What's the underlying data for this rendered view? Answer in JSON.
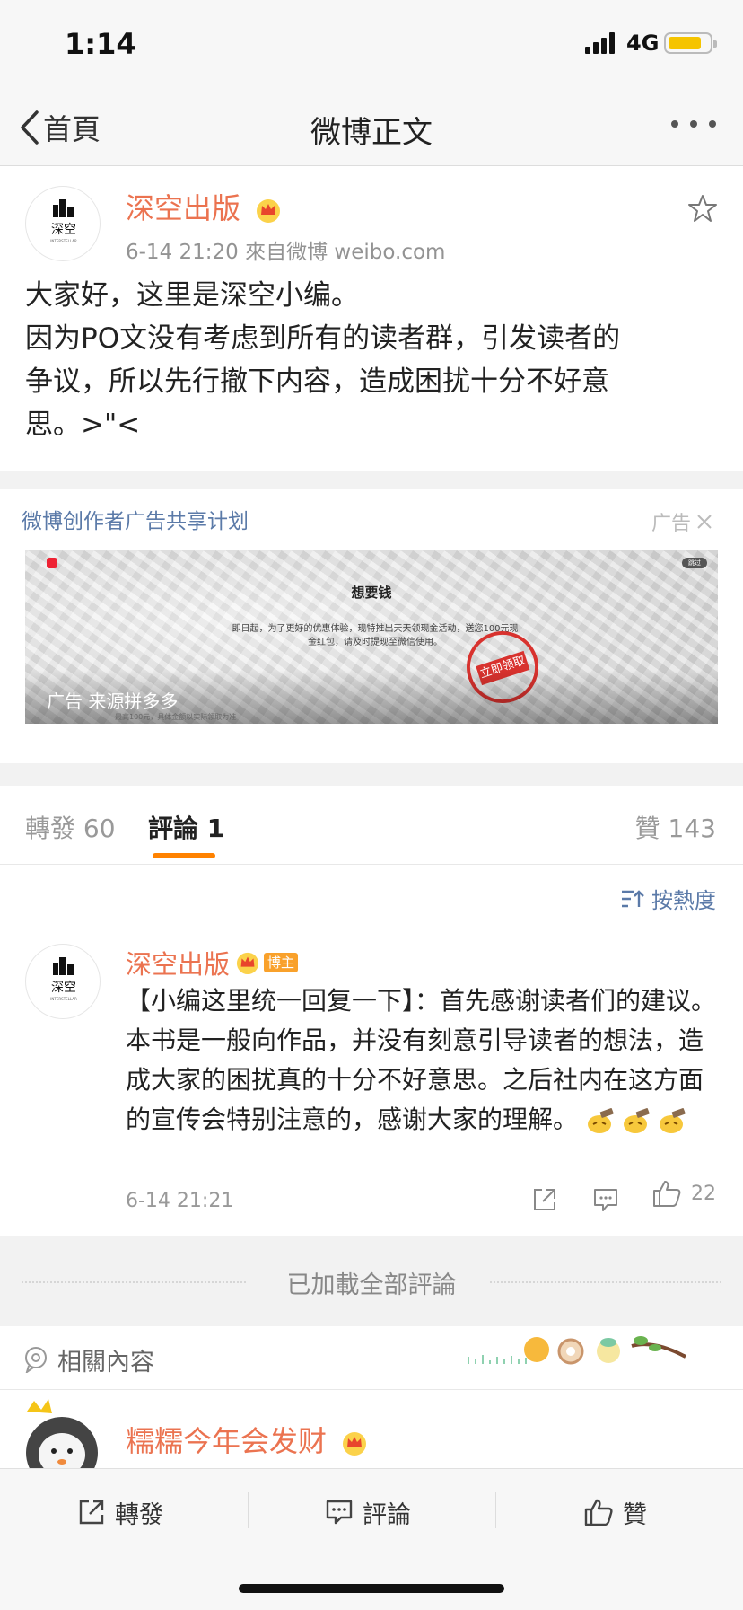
{
  "status_bar": {
    "time": "1:14",
    "network": "4G"
  },
  "nav": {
    "back_label": "首頁",
    "title": "微博正文"
  },
  "post": {
    "author": "深空出版",
    "meta": "6-14 21:20  來自微博 weibo.com",
    "lines": [
      "大家好，这里是深空小编。",
      "因为PO文没有考虑到所有的读者群，引发读者的",
      "争议，所以先行撤下内容，造成困扰十分不好意",
      "思。>\"<"
    ]
  },
  "ad": {
    "title": "微博创作者广告共享计划",
    "tag": "广告",
    "headline": "想要钱",
    "body": "即日起，为了更好的优惠体验，现特推出天天领现金活动，送您100元现金红包，请及时提现至微信使用。",
    "stamp": "立即领取",
    "corner": "跳过",
    "source": "广告 来源拼多多",
    "fine_print": "最高100元，具体金额以实际领取为准"
  },
  "tabs": {
    "repost": "轉發 60",
    "comment": "評論 1",
    "like": "贊 143"
  },
  "sort_label": "按熱度",
  "comment": {
    "author": "深空出版",
    "badge": "博主",
    "text": "【小编这里统一回复一下】：首先感谢读者们的建议。本书是一般向作品，并没有刻意引导读者的想法，造成大家的困扰真的十分不好意思。之后社内在这方面的宣传会特别注意的，感谢大家的理解。",
    "time": "6-14 21:21",
    "likes": "22"
  },
  "loaded_text": "已加載全部評論",
  "related": {
    "label": "相關內容",
    "item_author": "糯糯今年会发财"
  },
  "bottom_bar": {
    "repost": "轉發",
    "comment": "評論",
    "like": "贊"
  },
  "colors": {
    "brand_orange": "#eb7350",
    "link_blue": "#5b7aa8",
    "tab_indicator": "#ff8200"
  }
}
